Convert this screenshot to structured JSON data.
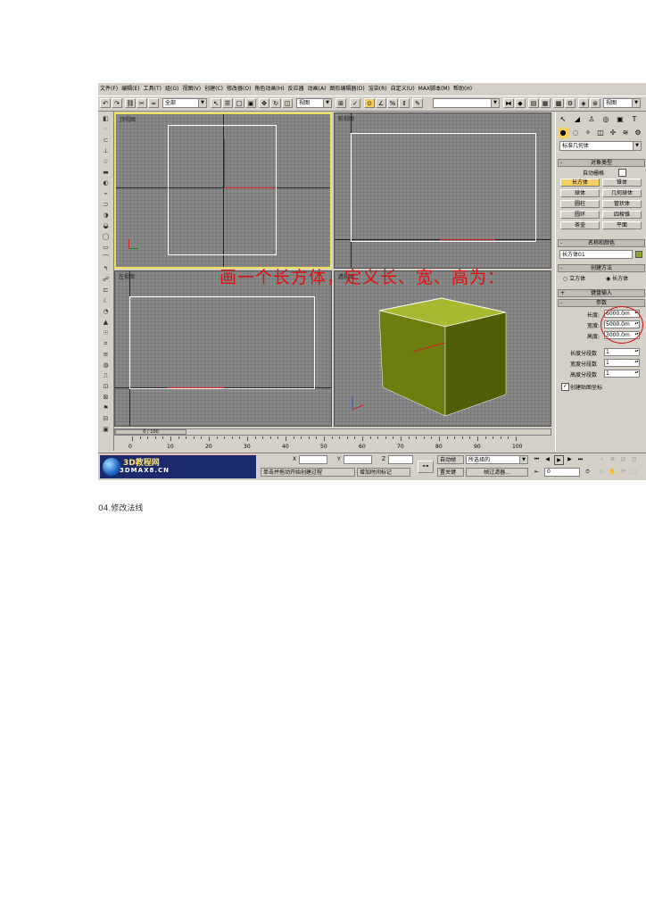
{
  "menu": [
    "文件(F)",
    "编辑(E)",
    "工具(T)",
    "组(G)",
    "视图(V)",
    "创建(C)",
    "修改器(O)",
    "角色动画(H)",
    "反应器",
    "动画(A)",
    "图形编辑器(D)",
    "渲染(R)",
    "自定义(U)",
    "MAX脚本(M)",
    "帮助(H)"
  ],
  "toolbar": {
    "selection_filter": "全部",
    "ref_coord": "视图",
    "named_selection": "",
    "right_view_combo": "视图"
  },
  "viewports": {
    "top_label": "顶视图",
    "front_label": "前视图",
    "left_label": "左视图",
    "persp_label": "透视图"
  },
  "caption": "画一个长方体，定义长、宽、高为：",
  "command_panel": {
    "category": "标准几何体",
    "object_type_title": "对象类型",
    "autogrid": "自动栅格",
    "buttons": [
      "长方体",
      "锥体",
      "球体",
      "几何球体",
      "圆柱",
      "管状体",
      "圆环",
      "四棱锥",
      "茶壶",
      "平面"
    ],
    "name_color_title": "名称和颜色",
    "object_name": "长方体01",
    "creation_method_title": "创建方法",
    "cube": "立方体",
    "box": "长方体",
    "keyboard_entry_title": "键盘输入",
    "params_title": "参数",
    "length_label": "长度:",
    "length_value": "6000.0m",
    "width_label": "宽度:",
    "width_value": "5000.0m",
    "height_label": "高度:",
    "height_value": "3000.0m",
    "length_segs_label": "长度分段数",
    "length_segs": "1",
    "width_segs_label": "宽度分段数",
    "width_segs": "1",
    "height_segs_label": "高度分段数",
    "height_segs": "1",
    "gen_map_coords": "创建贴图坐标"
  },
  "timeline": {
    "frame_counter": "0 / 100",
    "ticks": [
      "0",
      "10",
      "20",
      "30",
      "40",
      "50",
      "60",
      "70",
      "80",
      "90",
      "100"
    ]
  },
  "status": {
    "logo_main": "3D教程网",
    "logo_sub": "3DMAX8.CN",
    "x_label": "X",
    "y_label": "Y",
    "z_label": "Z",
    "prompt": "单击并拖动开始创建过程",
    "add_time_tag": "增加时间标记",
    "auto_key": "自动帧",
    "set_key": "置关键",
    "selected_combo": "所选择的",
    "key_filters": "帧过滤器...",
    "frame_field": "0"
  },
  "footer_caption": "04.修改法线",
  "colors": {
    "box_front": "#6e7d10",
    "box_top": "#a8b830",
    "box_side": "#505e08",
    "caption_red": "#e01010"
  }
}
